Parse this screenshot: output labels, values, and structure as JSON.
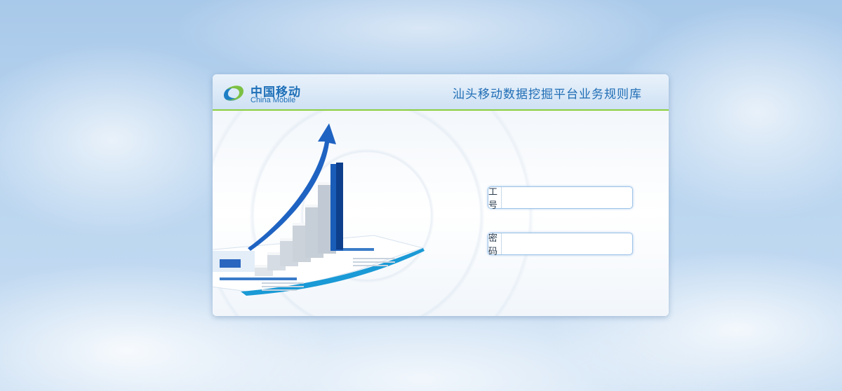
{
  "brand": {
    "logo_cn": "中国移动",
    "logo_en": "China Mobile"
  },
  "header": {
    "title": "汕头移动数据挖掘平台业务规则库"
  },
  "login": {
    "employee_id_label": "工号",
    "employee_id_value": "",
    "password_label": "密码",
    "password_value": ""
  },
  "colors": {
    "brand_blue": "#1d6fb8",
    "accent_green": "#8ccf3e",
    "field_border": "#9dc3e8"
  }
}
